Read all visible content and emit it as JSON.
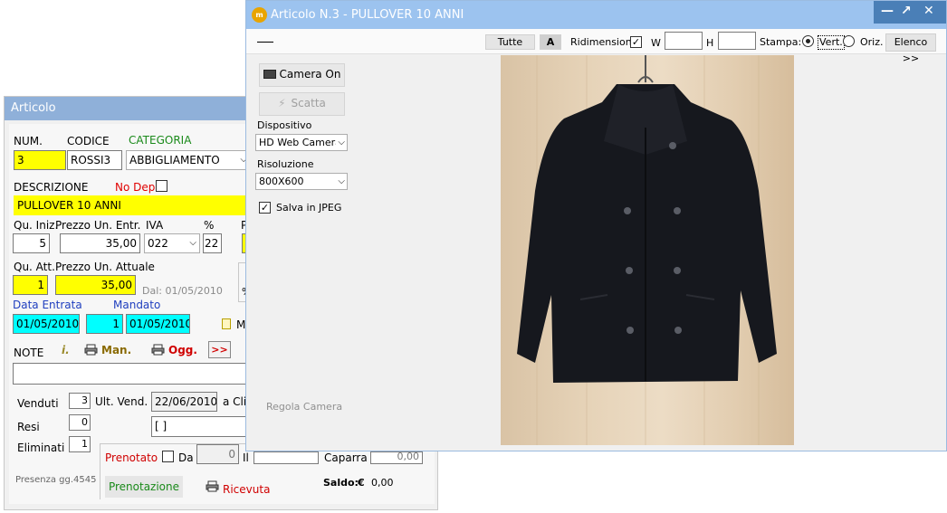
{
  "background_window": {
    "title": "Articolo",
    "num_label": "NUM.",
    "codice_label": "CODICE",
    "categoria_label": "CATEGORIA",
    "num_value": "3",
    "codice_value": "ROSSI3",
    "categoria_value": "ABBIGLIAMENTO",
    "descrizione_label": "DESCRIZIONE",
    "no_dep_label": "No Dep.",
    "descrizione_value": "PULLOVER 10 ANNI",
    "qu_iniz_label": "Qu. Iniz.",
    "prezzo_entr_label": "Prezzo Un. Entr.",
    "iva_label": "IVA",
    "pct_label": "%",
    "p_label": "P",
    "qu_iniz_value": "5",
    "prezzo_entr_value": "35,00",
    "iva_value": "022",
    "pct_value": "22",
    "qu_att_label": "Qu. Att.",
    "prezzo_att_label": "Prezzo Un. Attuale",
    "qu_att_value": "1",
    "prezzo_att_value": "35,00",
    "dal_text": "Dal: 01/05/2010",
    "pct_side": "%",
    "data_entrata_label": "Data Entrata",
    "mandato_label": "Mandato",
    "data_entrata_value": "01/05/2010",
    "mandato_num": "1",
    "mandato_date": "01/05/2010",
    "m_label": "M",
    "note_label": "NOTE",
    "info_label": "i.",
    "man_label": "Man.",
    "ogg_label": "Ogg.",
    "more_label": ">>",
    "venduti_label": "Venduti",
    "venduti_value": "3",
    "ult_vend_label": "Ult. Vend.",
    "ult_vend_value": "22/06/2010",
    "a_cli_label": "a Cli",
    "resi_label": "Resi",
    "resi_value": "0",
    "brackets_value": "[ ]",
    "eliminati_label": "Eliminati",
    "eliminati_value": "1",
    "prenotato_label": "Prenotato",
    "da_label": "Da",
    "da_value": "0",
    "il_label": "Il",
    "caparra_label": "Caparra",
    "caparra_value": "0,00",
    "presenza_text": "Presenza gg.4545",
    "prenotazione_label": "Prenotazione",
    "ricevuta_label": "Ricevuta",
    "saldo_label": "Saldo:",
    "saldo_currency": "€",
    "saldo_value": "0,00"
  },
  "camera_window": {
    "title": "Articolo N.3 - PULLOVER 10 ANNI",
    "logo_text": "m",
    "toolbar": {
      "tutte_label": "Tutte",
      "a_label": "A",
      "ridimensiona_label": "Ridimensiona",
      "w_label": "W",
      "h_label": "H",
      "stampa_label": "Stampa:",
      "vert_label": "Vert.",
      "oriz_label": "Oriz.",
      "elenco_label": "Elenco >>"
    },
    "camera_on_label": "Camera On",
    "scatta_label": "Scatta",
    "dispositivo_label": "Dispositivo",
    "dispositivo_value": "HD Web Camera",
    "risoluzione_label": "Risoluzione",
    "risoluzione_value": "800X600",
    "salva_label": "Salva in JPEG",
    "regola_label": "Regola Camera"
  }
}
